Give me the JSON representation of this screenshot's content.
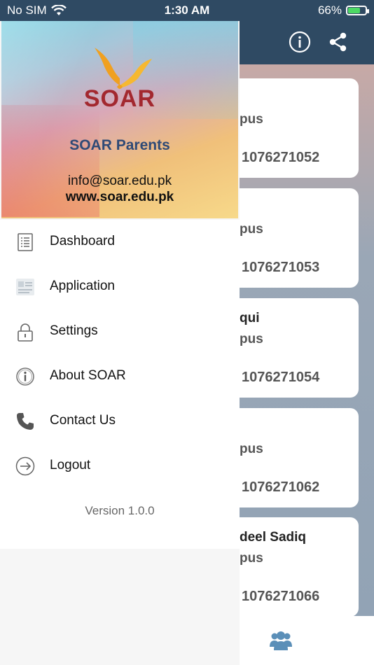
{
  "status_bar": {
    "carrier": "No SIM",
    "time": "1:30 AM",
    "battery": "66%"
  },
  "background": {
    "cards": [
      {
        "name": "",
        "campus": "pus",
        "number": "1076271052"
      },
      {
        "name": "",
        "campus": "pus",
        "number": "1076271053"
      },
      {
        "name": "qui",
        "campus": "pus",
        "number": "1076271054"
      },
      {
        "name": "",
        "campus": "pus",
        "number": "1076271062"
      },
      {
        "name": "deel Sadiq",
        "campus": "pus",
        "number": "1076271066"
      }
    ]
  },
  "drawer": {
    "logo_text": "SOAR",
    "app_name": "SOAR Parents",
    "email": "info@soar.edu.pk",
    "website": "www.soar.edu.pk",
    "menu": [
      {
        "label": "Dashboard",
        "icon": "list-document-icon"
      },
      {
        "label": "Application",
        "icon": "application-form-icon"
      },
      {
        "label": "Settings",
        "icon": "lock-icon"
      },
      {
        "label": "About SOAR",
        "icon": "info-icon"
      },
      {
        "label": "Contact Us",
        "icon": "phone-icon"
      },
      {
        "label": "Logout",
        "icon": "logout-icon"
      }
    ],
    "version": "Version 1.0.0"
  },
  "colors": {
    "header": "#2f4a63",
    "brand_red": "#a3282f",
    "brand_blue": "#2f4a76",
    "battery_green": "#4cd964",
    "users_icon": "#5b8fb8"
  }
}
